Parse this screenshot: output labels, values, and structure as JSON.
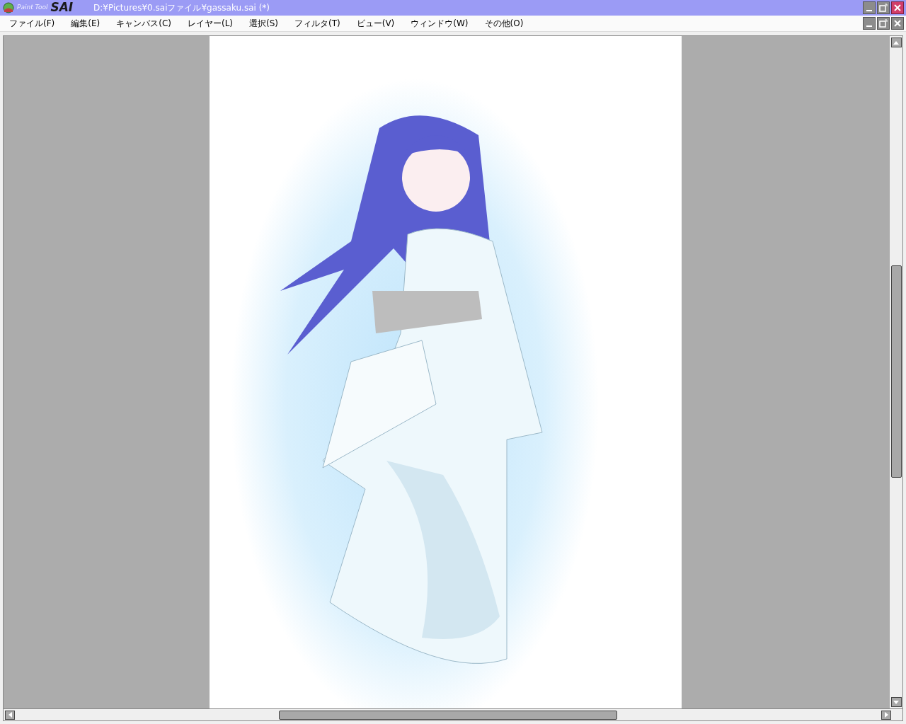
{
  "window": {
    "logo": {
      "small": "Paint Tool",
      "large": "SAI"
    },
    "title": "D:¥Pictures¥0.saiファイル¥gassaku.sai (*)"
  },
  "menu": [
    {
      "label": "ファイル(F)"
    },
    {
      "label": "編集(E)"
    },
    {
      "label": "キャンバス(C)"
    },
    {
      "label": "レイヤー(L)"
    },
    {
      "label": "選択(S)"
    },
    {
      "label": "フィルタ(T)"
    },
    {
      "label": "ビュー(V)"
    },
    {
      "label": "ウィンドウ(W)"
    },
    {
      "label": "その他(O)"
    }
  ]
}
